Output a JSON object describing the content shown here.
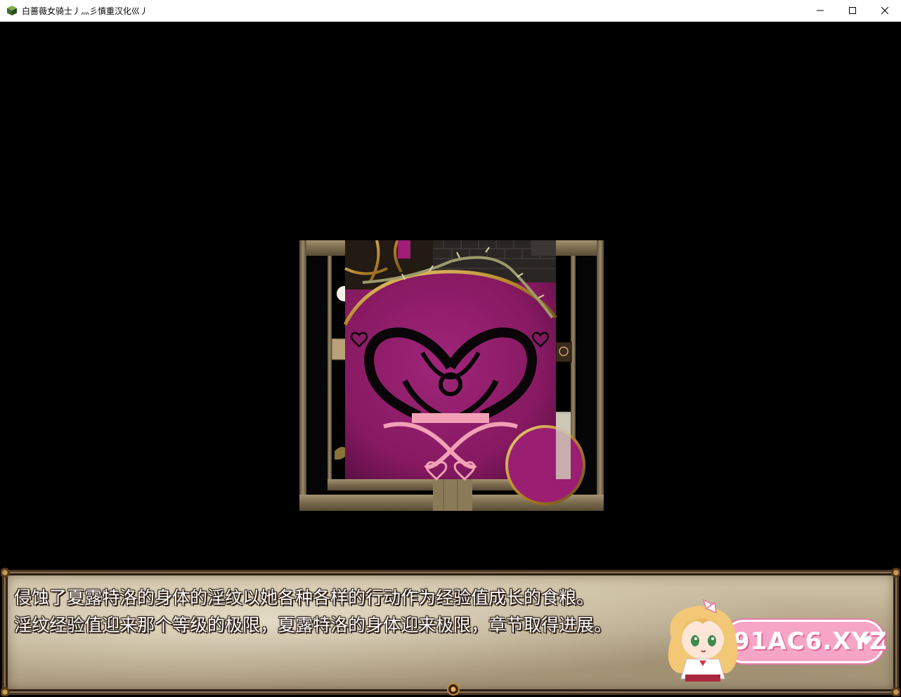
{
  "window": {
    "title": "白蔷薇女骑士丿灬彡慎重汉化巛丿",
    "icon": "game-cube-icon",
    "controls": [
      "minimize-icon",
      "maximize-icon",
      "close-icon"
    ]
  },
  "message": {
    "lines": [
      "侵蚀了夏露特洛的身体的淫纹以她各种各样的行动作为经验值成长的食粮。",
      "淫纹经验值迎来那个等级的极限，夏露特洛的身体迎来极限，章节取得进展。"
    ],
    "pause_indicator": "pause-cursor-icon"
  },
  "watermark": {
    "text": "91AC6.XYZ",
    "mascot": "chibi-girl-icon"
  },
  "colors": {
    "window_bg": "#000000",
    "message_bg": "#bfb193",
    "message_border": "#4a3826",
    "crest_magenta": "#8e1a67",
    "watermark_pink": "#f7a5c6"
  }
}
